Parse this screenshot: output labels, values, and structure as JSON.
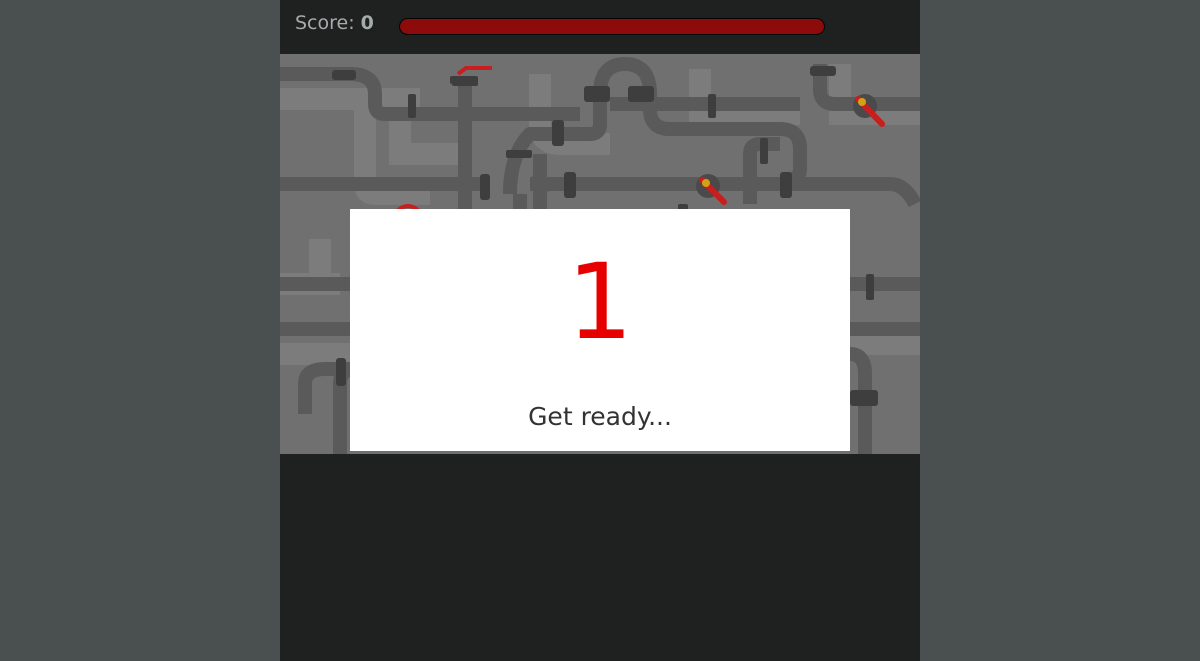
{
  "hud": {
    "score_label": "Score:",
    "score_value": "0",
    "timer_fraction": 1.0,
    "timer_color": "#8e0b0b"
  },
  "modal": {
    "countdown": "1",
    "message": "Get ready...",
    "countdown_color": "#e60000"
  },
  "colors": {
    "page_background": "#4a4f4f",
    "game_background": "#1f2121",
    "playfield_background": "#707070",
    "pipe": "#555555",
    "valve": "#c81e1e"
  }
}
